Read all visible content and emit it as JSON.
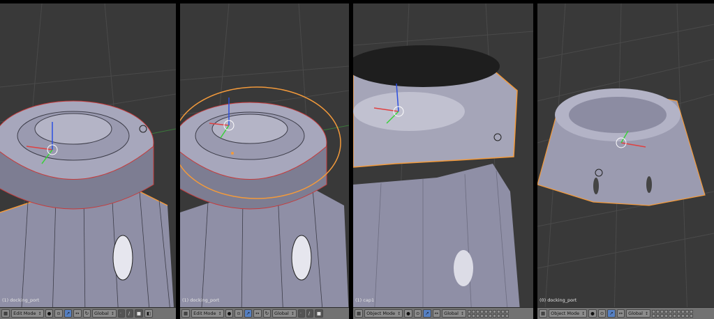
{
  "panels": [
    {
      "object_label": "(1) docking_port",
      "mode": "Edit Mode",
      "orientation": "Global"
    },
    {
      "object_label": "(1) docking_port",
      "mode": "Edit Mode",
      "orientation": "Global"
    },
    {
      "object_label": "(1) cap1",
      "mode": "Object Mode",
      "orientation": "Global"
    },
    {
      "object_label": "(0) docking_port",
      "mode": "Object Mode",
      "orientation": "Global"
    }
  ],
  "colors": {
    "viewport_bg": "#393939",
    "grid": "#4a4a4a",
    "mesh_face": "#9d9db3",
    "mesh_shadow": "#6e6e82",
    "edge_select": "#f39a3b",
    "seam": "#c73a3a",
    "axis_x": "#e04040",
    "axis_y": "#3ad13a",
    "axis_z": "#2b4ee0",
    "header": "#727272"
  }
}
